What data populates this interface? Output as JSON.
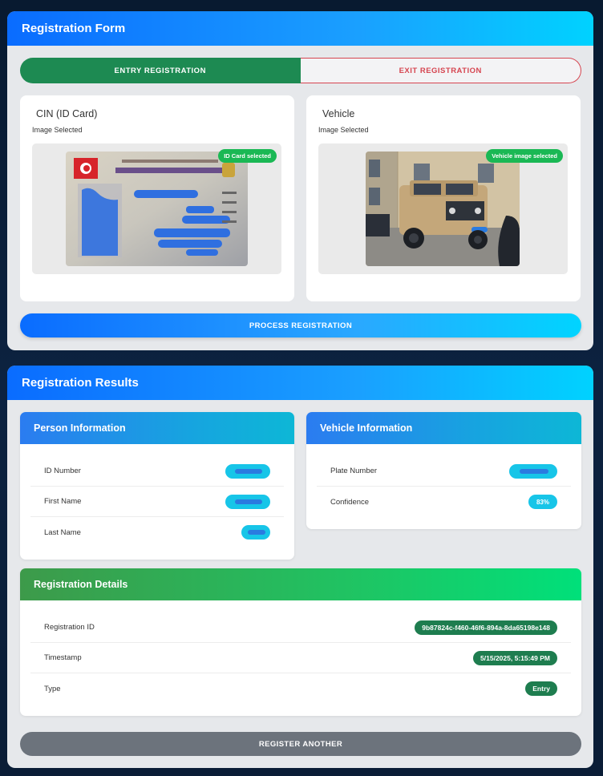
{
  "form": {
    "title": "Registration Form",
    "toggle": {
      "entry_label": "ENTRY REGISTRATION",
      "exit_label": "EXIT REGISTRATION",
      "selected": "entry"
    },
    "cin": {
      "title": "CIN (ID Card)",
      "status": "Image Selected",
      "badge": "ID Card selected"
    },
    "vehicle": {
      "title": "Vehicle",
      "status": "Image Selected",
      "badge": "Vehicle image selected"
    },
    "process_button": "PROCESS REGISTRATION"
  },
  "results": {
    "title": "Registration Results",
    "person": {
      "header": "Person Information",
      "rows": [
        {
          "label": "ID Number",
          "value": ""
        },
        {
          "label": "First Name",
          "value": ""
        },
        {
          "label": "Last Name",
          "value": ""
        }
      ]
    },
    "vehicle": {
      "header": "Vehicle Information",
      "rows": [
        {
          "label": "Plate Number",
          "value": ""
        },
        {
          "label": "Confidence",
          "value": "83%"
        }
      ]
    },
    "details": {
      "header": "Registration Details",
      "rows": [
        {
          "label": "Registration ID",
          "value": "9b87824c-f460-46f6-894a-8da65198e148"
        },
        {
          "label": "Timestamp",
          "value": "5/15/2025, 5:15:49 PM"
        },
        {
          "label": "Type",
          "value": "Entry"
        }
      ]
    },
    "register_another": "REGISTER ANOTHER"
  },
  "colors": {
    "accent_blue": "#0a6cff",
    "cyan": "#00d2ff",
    "entry_green": "#1d8a52",
    "exit_red": "#d64550",
    "badge_green": "#1ab854",
    "pill_cyan": "#17c5e8",
    "neutral_button": "#6c737c"
  }
}
